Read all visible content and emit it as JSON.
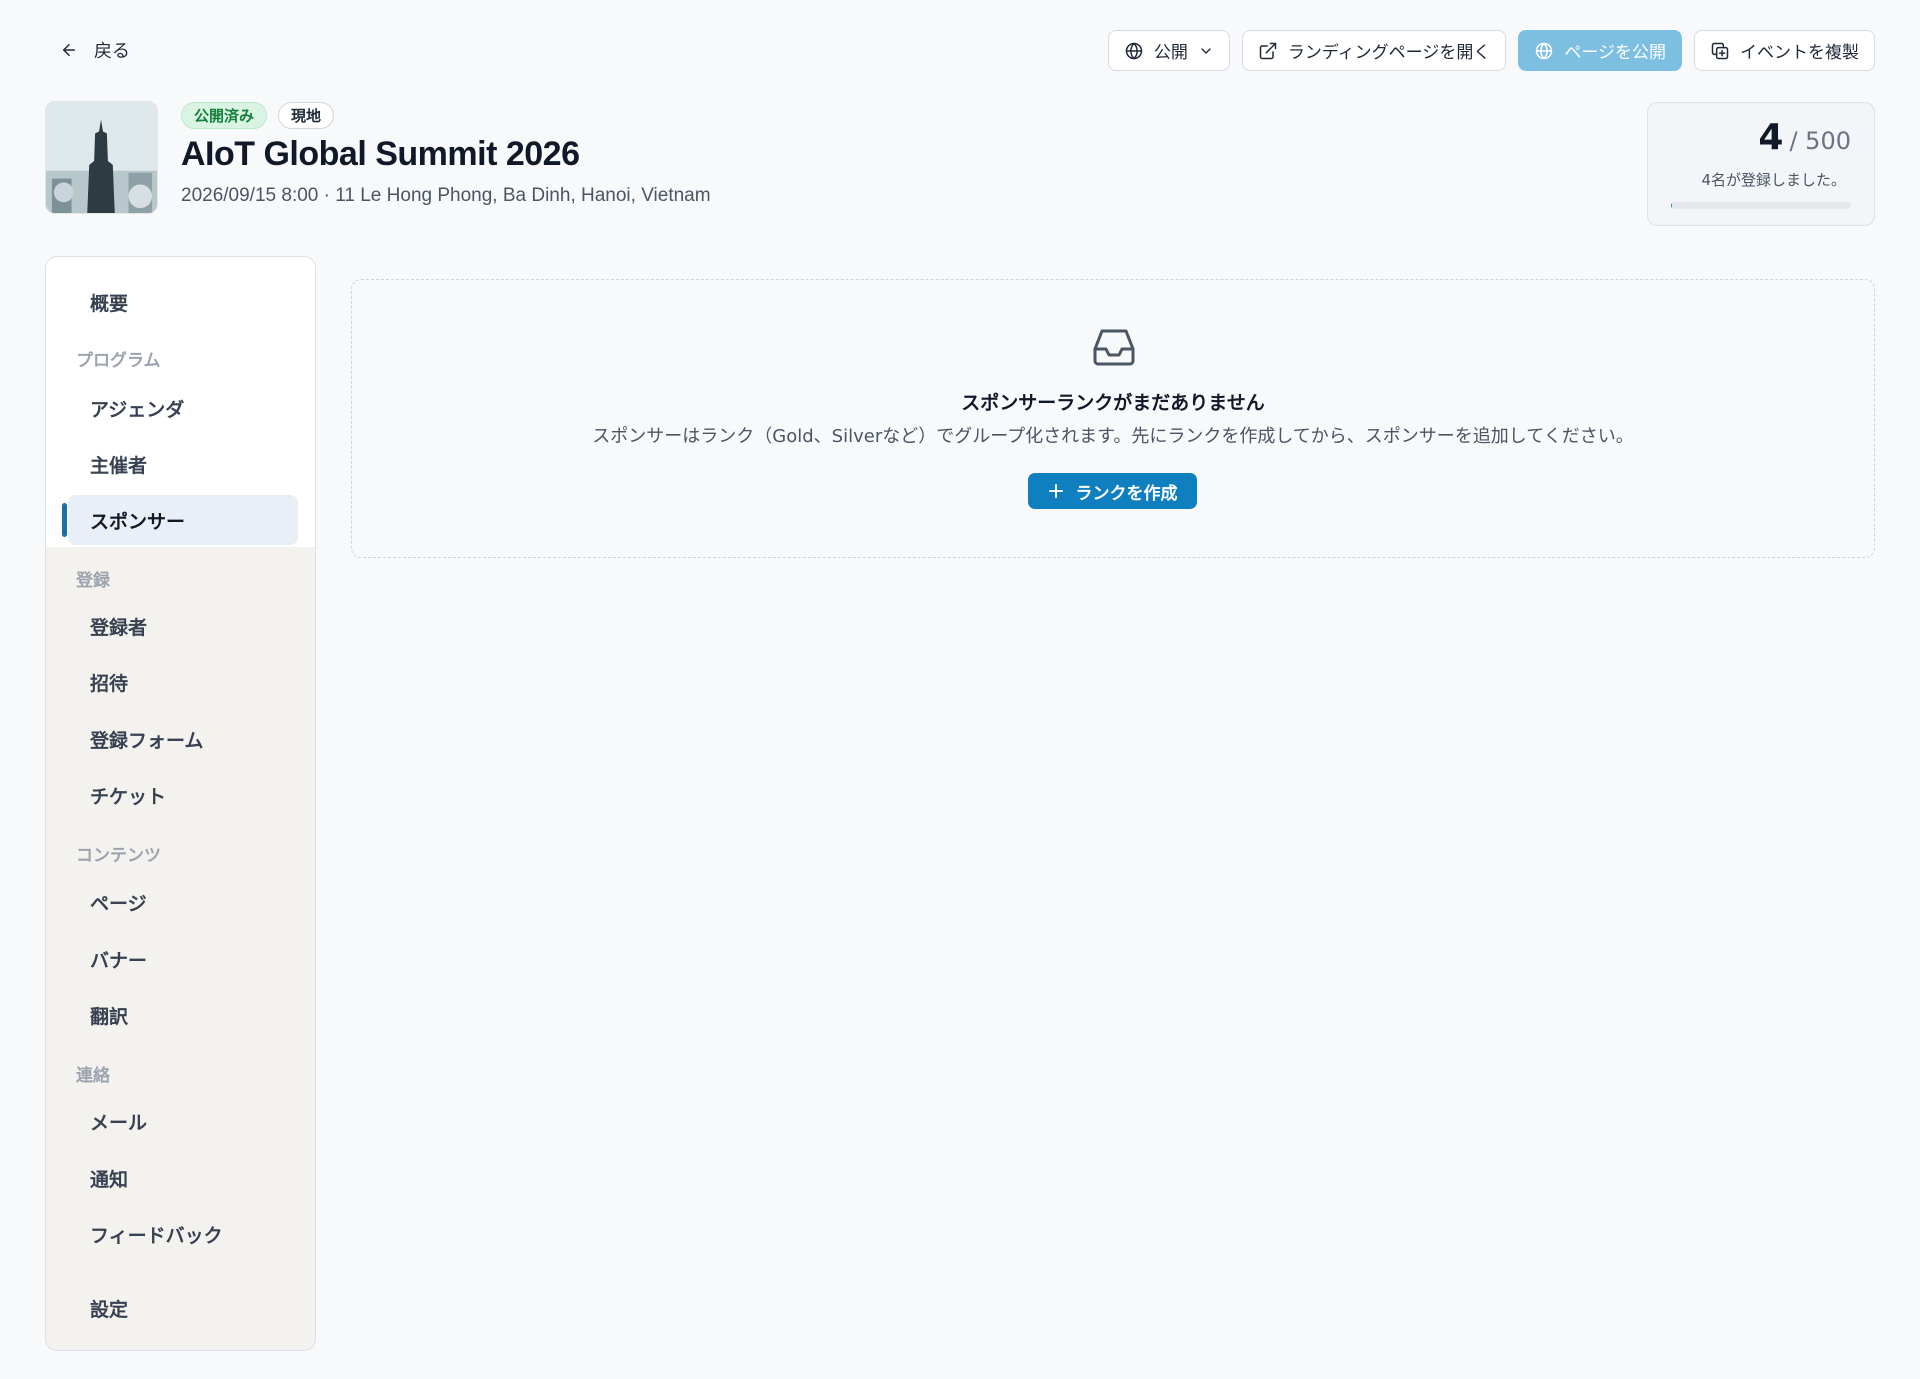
{
  "header": {
    "back_label": "戻る",
    "visibility_label": "公開",
    "open_landing_label": "ランディングページを開く",
    "publish_label": "ページを公開",
    "duplicate_label": "イベントを複製"
  },
  "event": {
    "status_badge": "公開済み",
    "type_badge": "現地",
    "title": "AIoT Global Summit 2026",
    "meta": "2026/09/15 8:00 · 11 Le Hong Phong, Ba Dinh, Hanoi, Vietnam"
  },
  "registration": {
    "count": "4",
    "total": "/ 500",
    "text": "4名が登録しました。",
    "progress_fraction": 0.008
  },
  "sidebar": {
    "overview": "概要",
    "sections": {
      "program": "プログラム",
      "registration": "登録",
      "content": "コンテンツ",
      "communication": "連絡"
    },
    "items": {
      "agenda": "アジェンダ",
      "organizers": "主催者",
      "sponsors": "スポンサー",
      "registrants": "登録者",
      "invitations": "招待",
      "registration_form": "登録フォーム",
      "tickets": "チケット",
      "pages": "ページ",
      "banners": "バナー",
      "translations": "翻訳",
      "email": "メール",
      "notifications": "通知",
      "feedback": "フィードバック",
      "settings": "設定"
    }
  },
  "empty_state": {
    "icon": "inbox-icon",
    "title": "スポンサーランクがまだありません",
    "description": "スポンサーはランク（Gold、Silverなど）でグループ化されます。先にランクを作成してから、スポンサーを追加してください。",
    "button_label": "ランクを作成"
  },
  "colors": {
    "accent": "#0f7fbf",
    "accent_disabled": "#7cbfe0",
    "success_badge_bg": "#d9f4e2",
    "success_badge_text": "#15803d"
  }
}
